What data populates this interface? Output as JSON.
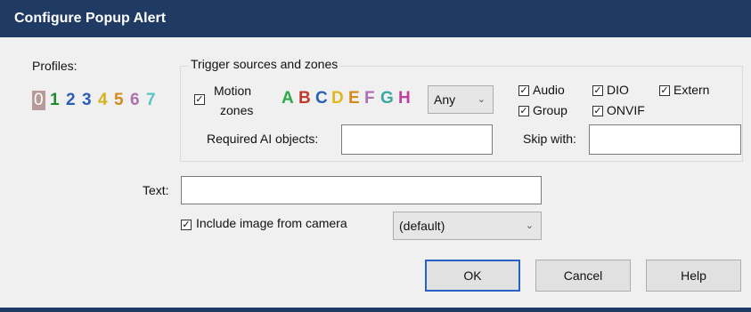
{
  "window": {
    "title": "Configure Popup Alert"
  },
  "profiles": {
    "label": "Profiles:",
    "items": [
      {
        "label": "0",
        "color": "#ffffff",
        "bg": "#b89a9a"
      },
      {
        "label": "1",
        "color": "#1f8a2e"
      },
      {
        "label": "2",
        "color": "#2a5fb8"
      },
      {
        "label": "3",
        "color": "#2a5fb8"
      },
      {
        "label": "4",
        "color": "#d6b21a"
      },
      {
        "label": "5",
        "color": "#d48a18"
      },
      {
        "label": "6",
        "color": "#b070b0"
      },
      {
        "label": "7",
        "color": "#58c4c4"
      }
    ]
  },
  "trigger": {
    "group_title": "Trigger sources and zones",
    "motion_line1": "Motion",
    "motion_line2": "zones",
    "motion_checked": true,
    "zones": [
      {
        "label": "A",
        "color": "#2ea84a"
      },
      {
        "label": "B",
        "color": "#c0392b"
      },
      {
        "label": "C",
        "color": "#2a5fb8"
      },
      {
        "label": "D",
        "color": "#e0b81a"
      },
      {
        "label": "E",
        "color": "#d48a18"
      },
      {
        "label": "F",
        "color": "#b070b0"
      },
      {
        "label": "G",
        "color": "#3aa8a0"
      },
      {
        "label": "H",
        "color": "#c040a0"
      }
    ],
    "zone_select": "Any",
    "sources": [
      {
        "label": "Audio",
        "checked": true
      },
      {
        "label": "DIO",
        "checked": true
      },
      {
        "label": "Extern",
        "checked": true
      },
      {
        "label": "Group",
        "checked": true
      },
      {
        "label": "ONVIF",
        "checked": true
      }
    ],
    "required_ai_label": "Required AI objects:",
    "required_ai_value": "",
    "skip_label": "Skip with:",
    "skip_value": ""
  },
  "text": {
    "label": "Text:",
    "value": ""
  },
  "include_image": {
    "label": "Include image from camera",
    "checked": true,
    "select_value": "(default)"
  },
  "buttons": {
    "ok": "OK",
    "cancel": "Cancel",
    "help": "Help"
  },
  "colors": {
    "titlebar": "#1f3b63",
    "dialog_bg": "#f0f0f0",
    "focus_border": "#2a61c9"
  },
  "icons": {
    "checkbox": "checkmark-icon",
    "dropdown": "chevron-down-icon"
  }
}
